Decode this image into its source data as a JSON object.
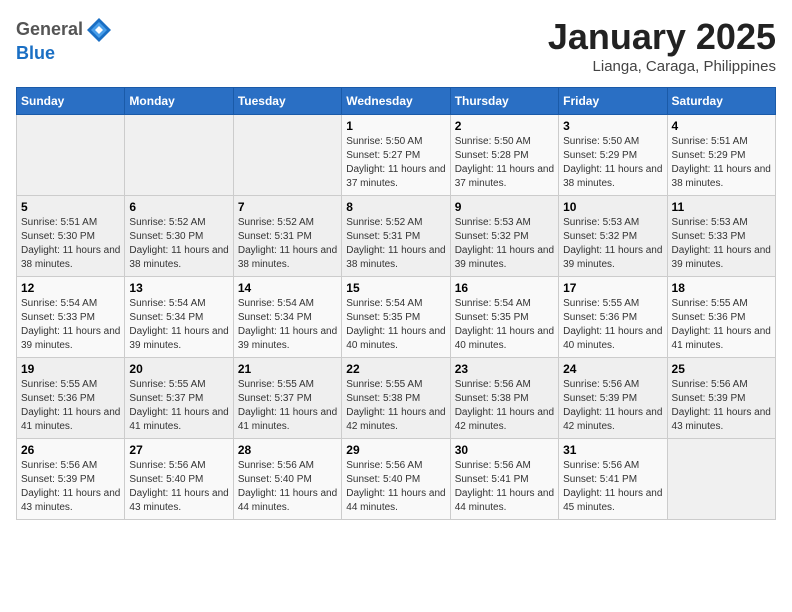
{
  "header": {
    "logo_line1": "General",
    "logo_line2": "Blue",
    "month": "January 2025",
    "location": "Lianga, Caraga, Philippines"
  },
  "weekdays": [
    "Sunday",
    "Monday",
    "Tuesday",
    "Wednesday",
    "Thursday",
    "Friday",
    "Saturday"
  ],
  "weeks": [
    [
      {
        "day": "",
        "info": ""
      },
      {
        "day": "",
        "info": ""
      },
      {
        "day": "",
        "info": ""
      },
      {
        "day": "1",
        "info": "Sunrise: 5:50 AM\nSunset: 5:27 PM\nDaylight: 11 hours and 37 minutes."
      },
      {
        "day": "2",
        "info": "Sunrise: 5:50 AM\nSunset: 5:28 PM\nDaylight: 11 hours and 37 minutes."
      },
      {
        "day": "3",
        "info": "Sunrise: 5:50 AM\nSunset: 5:29 PM\nDaylight: 11 hours and 38 minutes."
      },
      {
        "day": "4",
        "info": "Sunrise: 5:51 AM\nSunset: 5:29 PM\nDaylight: 11 hours and 38 minutes."
      }
    ],
    [
      {
        "day": "5",
        "info": "Sunrise: 5:51 AM\nSunset: 5:30 PM\nDaylight: 11 hours and 38 minutes."
      },
      {
        "day": "6",
        "info": "Sunrise: 5:52 AM\nSunset: 5:30 PM\nDaylight: 11 hours and 38 minutes."
      },
      {
        "day": "7",
        "info": "Sunrise: 5:52 AM\nSunset: 5:31 PM\nDaylight: 11 hours and 38 minutes."
      },
      {
        "day": "8",
        "info": "Sunrise: 5:52 AM\nSunset: 5:31 PM\nDaylight: 11 hours and 38 minutes."
      },
      {
        "day": "9",
        "info": "Sunrise: 5:53 AM\nSunset: 5:32 PM\nDaylight: 11 hours and 39 minutes."
      },
      {
        "day": "10",
        "info": "Sunrise: 5:53 AM\nSunset: 5:32 PM\nDaylight: 11 hours and 39 minutes."
      },
      {
        "day": "11",
        "info": "Sunrise: 5:53 AM\nSunset: 5:33 PM\nDaylight: 11 hours and 39 minutes."
      }
    ],
    [
      {
        "day": "12",
        "info": "Sunrise: 5:54 AM\nSunset: 5:33 PM\nDaylight: 11 hours and 39 minutes."
      },
      {
        "day": "13",
        "info": "Sunrise: 5:54 AM\nSunset: 5:34 PM\nDaylight: 11 hours and 39 minutes."
      },
      {
        "day": "14",
        "info": "Sunrise: 5:54 AM\nSunset: 5:34 PM\nDaylight: 11 hours and 39 minutes."
      },
      {
        "day": "15",
        "info": "Sunrise: 5:54 AM\nSunset: 5:35 PM\nDaylight: 11 hours and 40 minutes."
      },
      {
        "day": "16",
        "info": "Sunrise: 5:54 AM\nSunset: 5:35 PM\nDaylight: 11 hours and 40 minutes."
      },
      {
        "day": "17",
        "info": "Sunrise: 5:55 AM\nSunset: 5:36 PM\nDaylight: 11 hours and 40 minutes."
      },
      {
        "day": "18",
        "info": "Sunrise: 5:55 AM\nSunset: 5:36 PM\nDaylight: 11 hours and 41 minutes."
      }
    ],
    [
      {
        "day": "19",
        "info": "Sunrise: 5:55 AM\nSunset: 5:36 PM\nDaylight: 11 hours and 41 minutes."
      },
      {
        "day": "20",
        "info": "Sunrise: 5:55 AM\nSunset: 5:37 PM\nDaylight: 11 hours and 41 minutes."
      },
      {
        "day": "21",
        "info": "Sunrise: 5:55 AM\nSunset: 5:37 PM\nDaylight: 11 hours and 41 minutes."
      },
      {
        "day": "22",
        "info": "Sunrise: 5:55 AM\nSunset: 5:38 PM\nDaylight: 11 hours and 42 minutes."
      },
      {
        "day": "23",
        "info": "Sunrise: 5:56 AM\nSunset: 5:38 PM\nDaylight: 11 hours and 42 minutes."
      },
      {
        "day": "24",
        "info": "Sunrise: 5:56 AM\nSunset: 5:39 PM\nDaylight: 11 hours and 42 minutes."
      },
      {
        "day": "25",
        "info": "Sunrise: 5:56 AM\nSunset: 5:39 PM\nDaylight: 11 hours and 43 minutes."
      }
    ],
    [
      {
        "day": "26",
        "info": "Sunrise: 5:56 AM\nSunset: 5:39 PM\nDaylight: 11 hours and 43 minutes."
      },
      {
        "day": "27",
        "info": "Sunrise: 5:56 AM\nSunset: 5:40 PM\nDaylight: 11 hours and 43 minutes."
      },
      {
        "day": "28",
        "info": "Sunrise: 5:56 AM\nSunset: 5:40 PM\nDaylight: 11 hours and 44 minutes."
      },
      {
        "day": "29",
        "info": "Sunrise: 5:56 AM\nSunset: 5:40 PM\nDaylight: 11 hours and 44 minutes."
      },
      {
        "day": "30",
        "info": "Sunrise: 5:56 AM\nSunset: 5:41 PM\nDaylight: 11 hours and 44 minutes."
      },
      {
        "day": "31",
        "info": "Sunrise: 5:56 AM\nSunset: 5:41 PM\nDaylight: 11 hours and 45 minutes."
      },
      {
        "day": "",
        "info": ""
      }
    ]
  ]
}
